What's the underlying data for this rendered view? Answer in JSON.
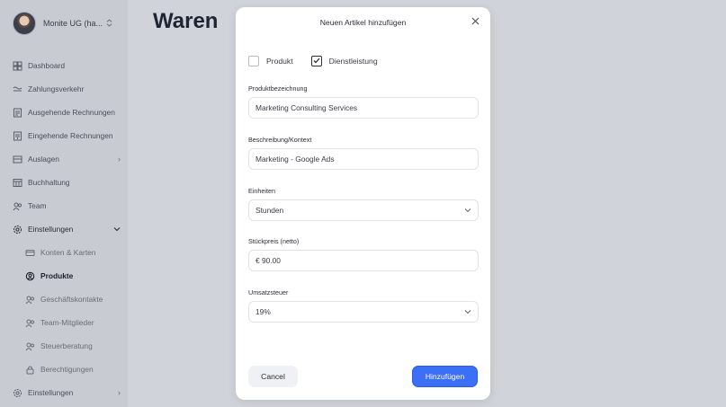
{
  "account": {
    "name": "Monite UG (ha...",
    "switch_icon": "chevron-updown-icon"
  },
  "sidebar": {
    "items": [
      {
        "label": "Dashboard",
        "icon": "dashboard-icon"
      },
      {
        "label": "Zahlungsverkehr",
        "icon": "transfer-icon"
      },
      {
        "label": "Ausgehende Rechnungen",
        "icon": "invoice-out-icon"
      },
      {
        "label": "Eingehende Rechnungen",
        "icon": "invoice-in-icon"
      },
      {
        "label": "Auslagen",
        "icon": "receipt-icon"
      },
      {
        "label": "Buchhaltung",
        "icon": "ledger-icon"
      },
      {
        "label": "Team",
        "icon": "team-icon"
      },
      {
        "label": "Einstellungen",
        "icon": "gear-icon"
      },
      {
        "label": "Konten & Karten",
        "icon": "card-icon"
      },
      {
        "label": "Produkte",
        "icon": "product-icon"
      },
      {
        "label": "Geschäftskontakte",
        "icon": "contacts-icon"
      },
      {
        "label": "Team-Mitglieder",
        "icon": "members-icon"
      },
      {
        "label": "Steuerberatung",
        "icon": "tax-advisor-icon"
      },
      {
        "label": "Berechtigungen",
        "icon": "lock-icon"
      },
      {
        "label": "Einstellungen",
        "icon": "gear-icon"
      }
    ]
  },
  "page": {
    "title": "Waren"
  },
  "modal": {
    "title": "Neuen Artikel hinzufügen",
    "types": [
      {
        "label": "Produkt",
        "checked": false
      },
      {
        "label": "Dienstleistung",
        "checked": true
      }
    ],
    "fields": {
      "name": {
        "label": "Produktbezeichnung",
        "value": "Marketing Consulting Services"
      },
      "description": {
        "label": "Beschreibung/Kontext",
        "value": "Marketing - Google Ads"
      },
      "units": {
        "label": "Einheiten",
        "value": "Stunden"
      },
      "price": {
        "label": "Stückpreis (netto)",
        "value": "€ 90.00"
      },
      "vat": {
        "label": "Umsatzsteuer",
        "value": "19%"
      }
    },
    "cancel_label": "Cancel",
    "submit_label": "Hinzufügen"
  },
  "colors": {
    "primary": "#3b6ff5",
    "sidebar_bg": "#c8cbd2",
    "backdrop": "#d0d3d9"
  }
}
